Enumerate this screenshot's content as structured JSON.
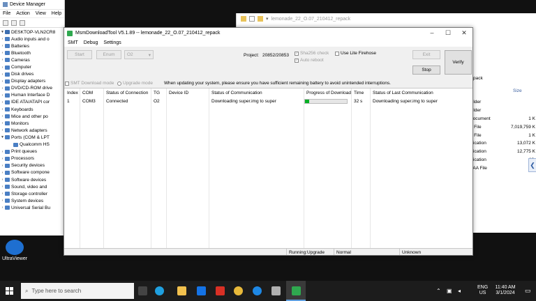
{
  "device_manager": {
    "title": "Device Manager",
    "menu": [
      "File",
      "Action",
      "View",
      "Help"
    ],
    "root": "DESKTOP-VLN2CR8",
    "items": [
      {
        "label": "Audio inputs and o",
        "child": false
      },
      {
        "label": "Batteries",
        "child": false
      },
      {
        "label": "Bluetooth",
        "child": false
      },
      {
        "label": "Cameras",
        "child": false
      },
      {
        "label": "Computer",
        "child": false
      },
      {
        "label": "Disk drives",
        "child": false
      },
      {
        "label": "Display adapters",
        "child": false
      },
      {
        "label": "DVD/CD-ROM drive",
        "child": false
      },
      {
        "label": "Human Interface D",
        "child": false
      },
      {
        "label": "IDE ATA/ATAPI cor",
        "child": false
      },
      {
        "label": "Keyboards",
        "child": false
      },
      {
        "label": "Mice and other po",
        "child": false
      },
      {
        "label": "Monitors",
        "child": false
      },
      {
        "label": "Network adapters",
        "child": false
      },
      {
        "label": "Ports (COM & LPT",
        "child": false
      },
      {
        "label": "Qualcomm HS",
        "child": true
      },
      {
        "label": "Print queues",
        "child": false
      },
      {
        "label": "Processors",
        "child": false
      },
      {
        "label": "Security devices",
        "child": false
      },
      {
        "label": "Software compone",
        "child": false
      },
      {
        "label": "Software devices",
        "child": false
      },
      {
        "label": "Sound, video and",
        "child": false
      },
      {
        "label": "Storage controller",
        "child": false
      },
      {
        "label": "System devices",
        "child": false
      },
      {
        "label": "Universal Serial Bu",
        "child": false
      }
    ]
  },
  "explorer": {
    "title": "lemonade_22_O.07_210412_repack",
    "breadcrumb_tail": "pack",
    "size_header": "Size",
    "rows": [
      {
        "type": "folder",
        "size": ""
      },
      {
        "type": "folder",
        "size": ""
      },
      {
        "type": "Document",
        "size": "1 K"
      },
      {
        "type": "S File",
        "size": "7,019,759 K"
      },
      {
        "type": "S File",
        "size": "1 K"
      },
      {
        "type": "plication",
        "size": "13,072 K"
      },
      {
        "type": "plication",
        "size": "12,775 K"
      },
      {
        "type": "plication",
        "size": "13,"
      },
      {
        "type": "SAA File",
        "size": ""
      }
    ]
  },
  "msm": {
    "title": "MsmDownloadTool V5.1.89 -- lemonade_22_O.07_210412_repack",
    "menu": [
      "SMT",
      "Debug",
      "Settings"
    ],
    "start_label": "Start",
    "enum_label": "Enum",
    "select_value": "O2",
    "project_label": "Project:",
    "project_value": "20852/20853",
    "sha256_label": "Sha256 check",
    "auto_reboot_label": "Auto reboot",
    "lite_firehose_label": "Use Lite Firehose",
    "exit_label": "Exit",
    "stop_label": "Stop",
    "verify_label": "Verify",
    "smt_mode_label": "SMT Download mode",
    "upgrade_mode_label": "Upgrade mode",
    "notice": "When updating your system, please ensure you have sufficient remaining battery to avoid unintended interruptions.",
    "columns": [
      "Index",
      "COM",
      "Status of Connection",
      "TG",
      "Device ID",
      "Status of Communication",
      "Progress of Download",
      "Time",
      "Status of Last Communication"
    ],
    "rows": [
      {
        "index": "1",
        "com": "COM3",
        "connection": "Connected",
        "tg": "O2",
        "device_id": "",
        "communication": "Downloading super.img to super",
        "progress": 0.1,
        "time": "32 s",
        "last_communication": "Downloading super.img to super"
      }
    ],
    "status": {
      "running": "Running:Upgrade",
      "mode": "Normal",
      "state": "Unknown"
    }
  },
  "desktop": {
    "ultraviewer_label": "UltraViewer"
  },
  "taskbar": {
    "search_placeholder": "Type here to search",
    "language": "ENG",
    "region": "US",
    "time": "11:40 AM",
    "date": "3/1/2024"
  },
  "colors": {
    "progress_fill": "#06b025",
    "accent_green": "#2fa84f"
  }
}
